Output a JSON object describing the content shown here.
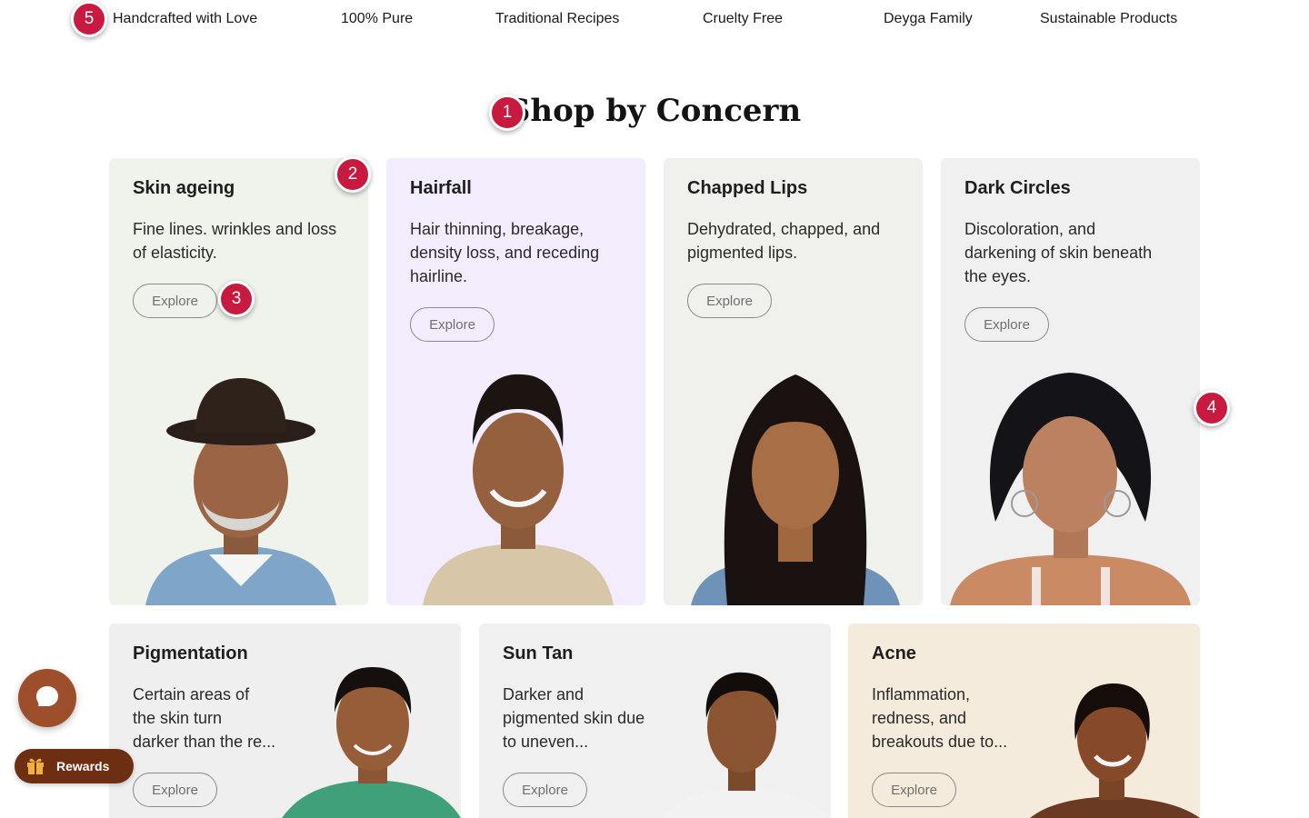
{
  "features": [
    "Handcrafted with Love",
    "100% Pure",
    "Traditional Recipes",
    "Cruelty Free",
    "Deyga Family",
    "Sustainable Products"
  ],
  "section": {
    "title": "Shop by Concern"
  },
  "concerns": [
    {
      "title": "Skin ageing",
      "desc_lines": [
        "Fine lines. wrinkles and loss",
        "of elasticity."
      ],
      "button": "Explore",
      "bg": "#f0f2ec"
    },
    {
      "title": "Hairfall",
      "desc_lines": [
        "Hair thinning, breakage,",
        "density loss, and receding",
        "hairline."
      ],
      "button": "Explore",
      "bg": "#f3ecfd"
    },
    {
      "title": "Chapped Lips",
      "desc_lines": [
        "Dehydrated, chapped, and",
        "pigmented lips."
      ],
      "button": "Explore",
      "bg": "#f0f1ec"
    },
    {
      "title": "Dark Circles",
      "desc_lines": [
        "Discoloration, and",
        "darkening of skin beneath",
        "the eyes."
      ],
      "button": "Explore",
      "bg": "#f0f0f0"
    },
    {
      "title": "Pigmentation",
      "desc_lines": [
        "Certain areas of",
        "the skin turn",
        "darker than the re..."
      ],
      "button": "Explore",
      "bg": "#efefef"
    },
    {
      "title": "Sun Tan",
      "desc_lines": [
        "Darker and",
        "pigmented skin due",
        "to uneven..."
      ],
      "button": "Explore",
      "bg": "#f0f0f0"
    },
    {
      "title": "Acne",
      "desc_lines": [
        "Inflammation,",
        "redness, and",
        "breakouts due to..."
      ],
      "button": "Explore",
      "bg": "#f5ebdc"
    }
  ],
  "badges": [
    "1",
    "2",
    "3",
    "4",
    "5"
  ],
  "widgets": {
    "rewards_label": "Rewards"
  },
  "colors": {
    "badge": "#c8193f",
    "chat": "#9c4f2a",
    "rewards": "#6e2e12"
  },
  "icons": [
    "chat-bubble-icon",
    "gift-icon"
  ]
}
